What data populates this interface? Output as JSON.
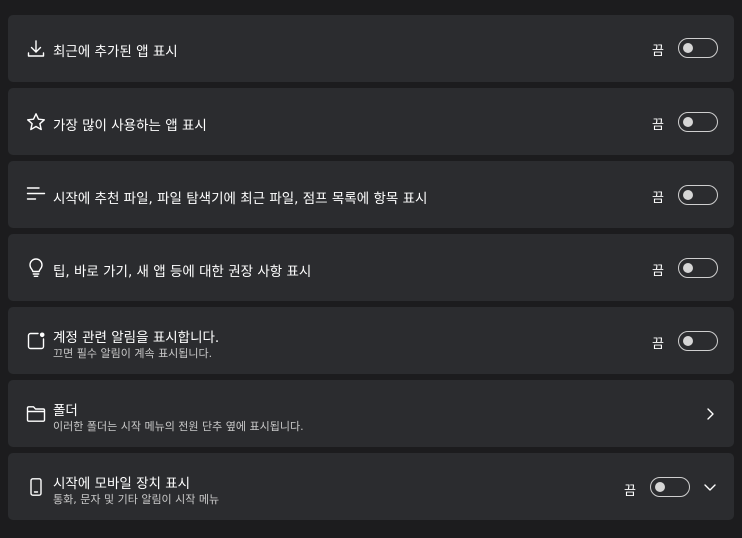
{
  "off_label": "끔",
  "rows": [
    {
      "title": "최근에 추가된 앱 표시",
      "icon": "download-icon"
    },
    {
      "title": "가장 많이 사용하는 앱 표시",
      "icon": "star-icon"
    },
    {
      "title": "시작에 추천 파일, 파일 탐색기에 최근 파일, 점프 목록에 항목 표시",
      "icon": "list-icon"
    },
    {
      "title": "팁, 바로 가기, 새 앱 등에 대한 권장 사항 표시",
      "icon": "lightbulb-icon"
    },
    {
      "title": "계정 관련 알림을 표시합니다.",
      "subtitle": "끄면 필수 알림이 계속 표시됩니다.",
      "icon": "notification-icon"
    },
    {
      "title": "폴더",
      "subtitle": "이러한 폴더는 시작 메뉴의 전원 단추 옆에 표시됩니다.",
      "icon": "folder-icon"
    },
    {
      "title": "시작에 모바일 장치 표시",
      "subtitle": "통화, 문자 및 기타 알림이 시작 메뉴",
      "icon": "phone-icon"
    }
  ],
  "colors": {
    "background": "#1c1c1e",
    "card": "#2b2c2f",
    "text": "#ffffff",
    "subtext": "#c9c9c9",
    "toggle_border": "#cfcfcf"
  }
}
